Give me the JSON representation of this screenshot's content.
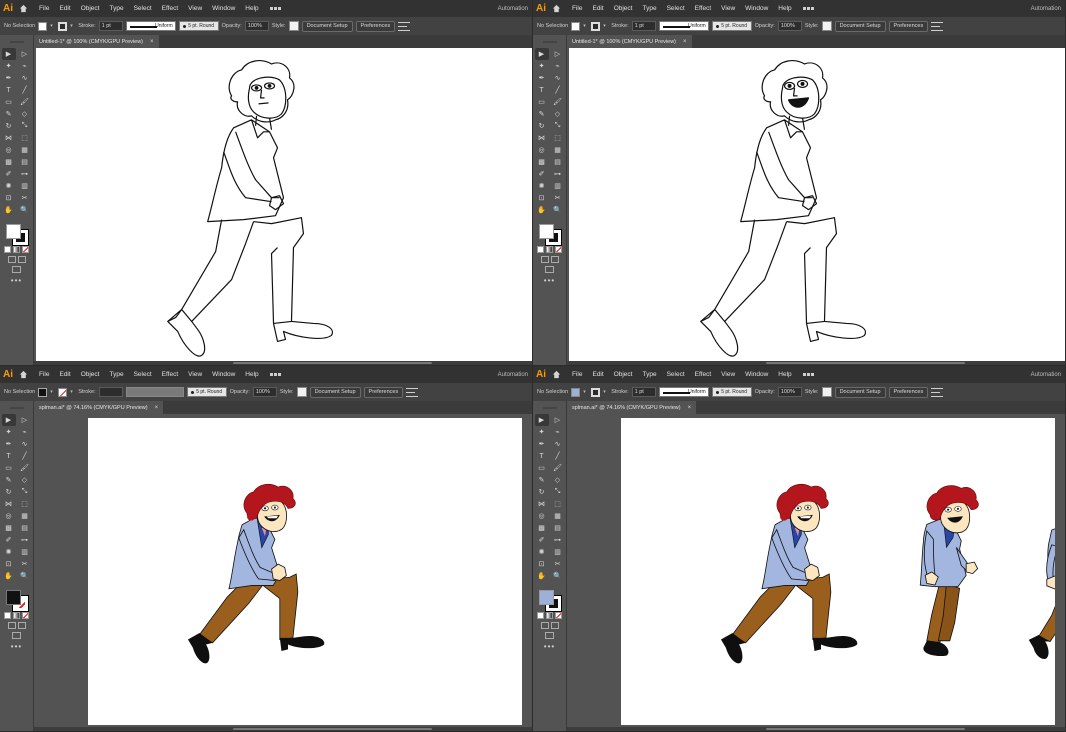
{
  "app": {
    "logo_text": "Ai",
    "menu": [
      "File",
      "Edit",
      "Object",
      "Type",
      "Select",
      "Effect",
      "View",
      "Window",
      "Help"
    ],
    "workspace": "Automation",
    "accent": "#ff9a00"
  },
  "control_bar": {
    "no_selection": "No Selection",
    "stroke_label": "Stroke:",
    "stroke_weight": "1 pt",
    "profile": "Uniform",
    "brush": "5 pt. Round",
    "opacity_label": "Opacity:",
    "opacity": "100%",
    "style_label": "Style:",
    "document_setup": "Document Setup",
    "preferences": "Preferences"
  },
  "panes": [
    {
      "tab": "Untitled-1* @ 100% (CMYK/GPU Preview)",
      "fill_color": "#ffffff",
      "stroke_color": "#111111"
    },
    {
      "tab": "Untitled-1* @ 100% (CMYK/GPU Preview)",
      "fill_color": "#ffffff",
      "stroke_color": "#111111"
    },
    {
      "tab": "splman.ai* @ 74.16% (CMYK/GPU Preview)",
      "fill_color": "#111111",
      "stroke_color": "none"
    },
    {
      "tab": "splman.ai* @ 74.16% (CMYK/GPU Preview)",
      "fill_color": "#9db0d9",
      "stroke_color": "#111111"
    }
  ],
  "tab_close": "×",
  "more_tools": "•••",
  "colors": {
    "hair": "#b3161d",
    "skin": "#fbe6c0",
    "jacket": "#a3b6df",
    "collar": "#2747a8",
    "pants": "#9a5f1c",
    "shoes": "#0f0f0f"
  }
}
